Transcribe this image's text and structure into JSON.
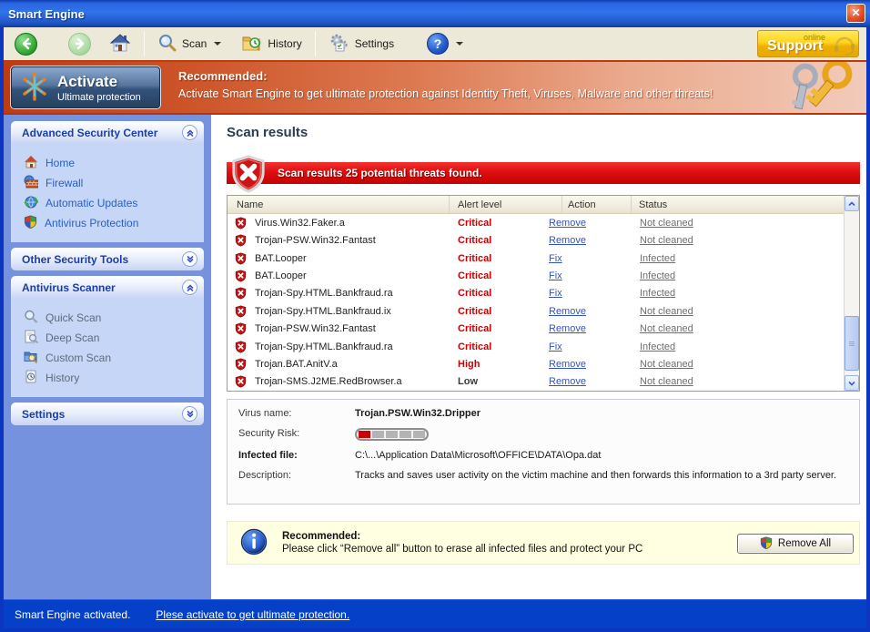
{
  "window": {
    "title": "Smart Engine",
    "close_glyph": "✕"
  },
  "toolbar": {
    "scan_label": "Scan",
    "history_label": "History",
    "settings_label": "Settings",
    "support": {
      "small": "online",
      "big": "Support"
    }
  },
  "banner": {
    "activate_title": "Activate",
    "activate_subtitle": "Ultimate protection",
    "recommended_label": "Recommended:",
    "message": "Activate Smart Engine to get ultimate protection against Identity Theft, Viruses, Malware and other threats!"
  },
  "sidebar": {
    "sections": [
      {
        "title": "Advanced Security Center",
        "expanded": true,
        "items": [
          {
            "label": "Home"
          },
          {
            "label": "Firewall"
          },
          {
            "label": "Automatic Updates"
          },
          {
            "label": "Antivirus Protection"
          }
        ]
      },
      {
        "title": "Other Security Tools",
        "expanded": false,
        "items": []
      },
      {
        "title": "Antivirus Scanner",
        "expanded": true,
        "items": [
          {
            "label": "Quick Scan"
          },
          {
            "label": "Deep Scan"
          },
          {
            "label": "Custom Scan"
          },
          {
            "label": "History"
          }
        ]
      },
      {
        "title": "Settings",
        "expanded": false,
        "items": []
      }
    ]
  },
  "main": {
    "page_title": "Scan results",
    "alert_banner": "Scan results 25 potential threats found.",
    "table": {
      "columns": [
        "Name",
        "Alert level",
        "Action",
        "Status"
      ],
      "alert_colors": {
        "Critical": "#cc0000",
        "High": "#cc0000",
        "Low": "#3a3a3a"
      },
      "rows": [
        {
          "name": "Virus.Win32.Faker.a",
          "level": "Critical",
          "action": "Remove",
          "status": "Not cleaned"
        },
        {
          "name": "Trojan-PSW.Win32.Fantast",
          "level": "Critical",
          "action": "Remove",
          "status": "Not cleaned"
        },
        {
          "name": "BAT.Looper",
          "level": "Critical",
          "action": "Fix",
          "status": "Infected"
        },
        {
          "name": "BAT.Looper",
          "level": "Critical",
          "action": "Fix",
          "status": "Infected"
        },
        {
          "name": "Trojan-Spy.HTML.Bankfraud.ra",
          "level": "Critical",
          "action": "Fix",
          "status": "Infected"
        },
        {
          "name": "Trojan-Spy.HTML.Bankfraud.ix",
          "level": "Critical",
          "action": "Remove",
          "status": "Not cleaned"
        },
        {
          "name": "Trojan-PSW.Win32.Fantast",
          "level": "Critical",
          "action": "Remove",
          "status": "Not cleaned"
        },
        {
          "name": "Trojan-Spy.HTML.Bankfraud.ra",
          "level": "Critical",
          "action": "Fix",
          "status": "Infected"
        },
        {
          "name": "Trojan.BAT.AnitV.a",
          "level": "High",
          "action": "Remove",
          "status": "Not cleaned"
        },
        {
          "name": "Trojan-SMS.J2ME.RedBrowser.a",
          "level": "Low",
          "action": "Remove",
          "status": "Not cleaned"
        }
      ]
    },
    "details": {
      "virus_name_label": "Virus name:",
      "virus_name": "Trojan.PSW.Win32.Dripper",
      "risk_label": "Security Risk:",
      "risk_segments": 5,
      "risk_filled": 1,
      "file_label": "Infected file:",
      "file_value": "C:\\...\\Application Data\\Microsoft\\OFFICE\\DATA\\Opa.dat",
      "description_label": "Description:",
      "description": "Tracks and saves user activity on the victim machine and then forwards this information to a 3rd party server."
    },
    "recommend": {
      "title": "Recommended:",
      "text": "Please click “Remove all” button to erase all infected files and protect your PC",
      "button_label": "Remove All"
    }
  },
  "statusbar": {
    "status": "Smart Engine activated.",
    "link": "Plese activate to get ultimate protection."
  }
}
